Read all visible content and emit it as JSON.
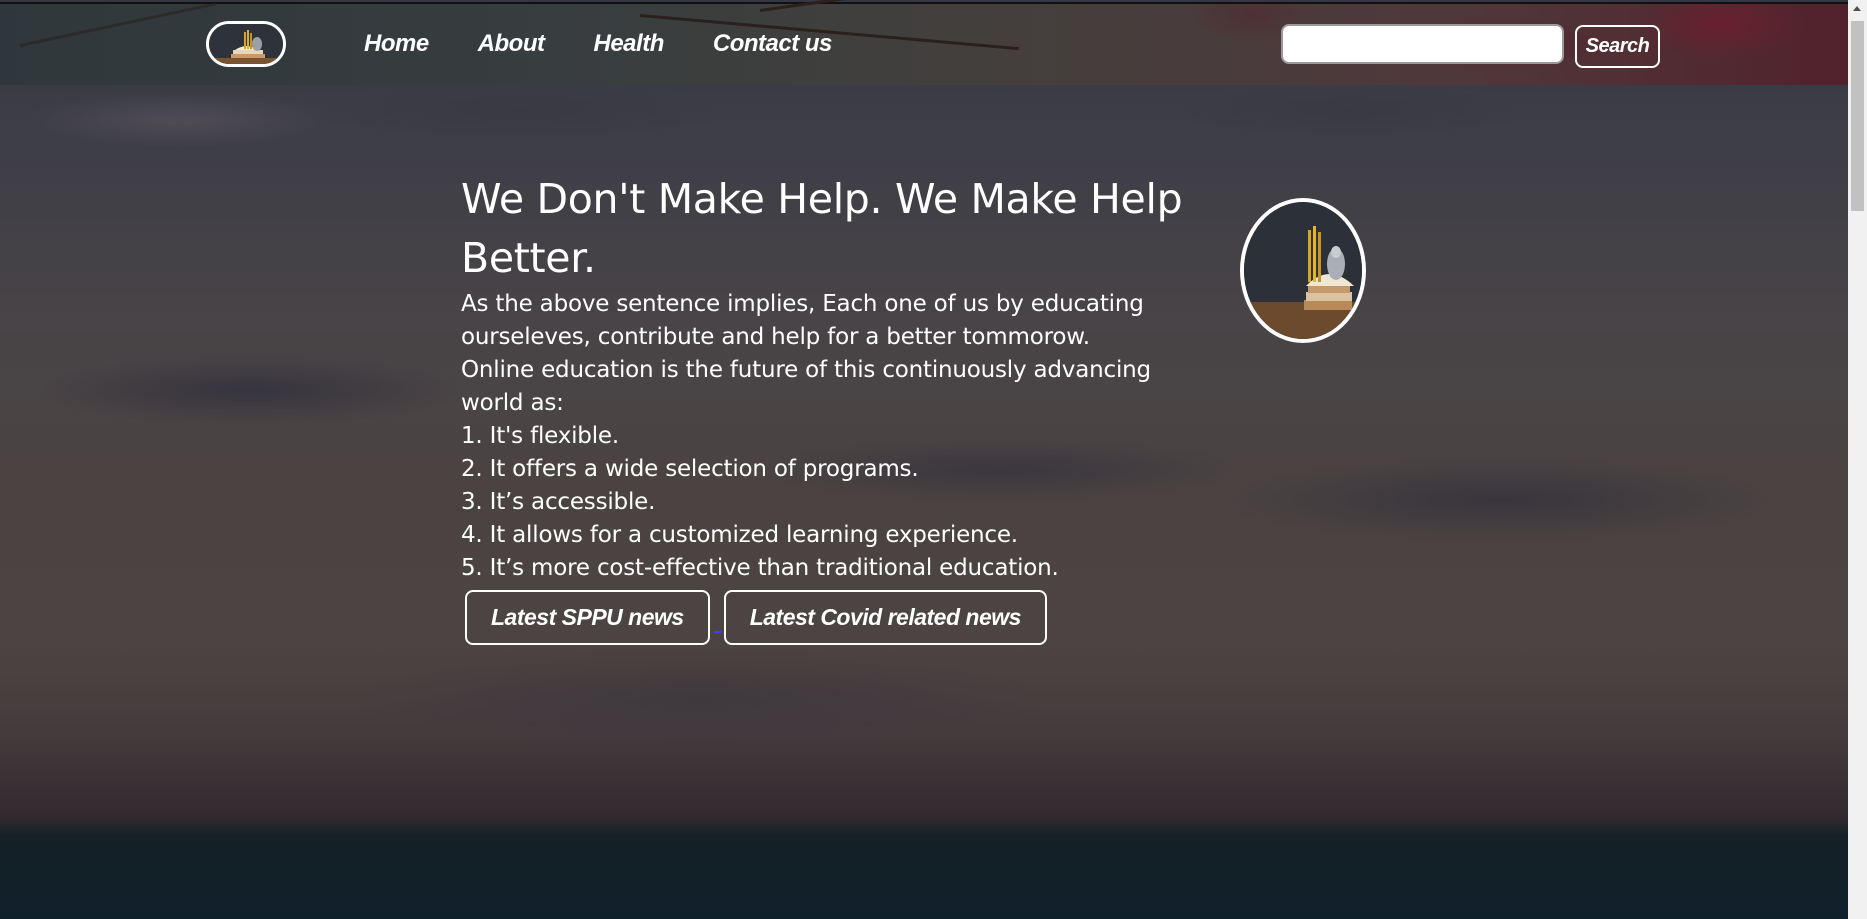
{
  "navbar": {
    "logo_name": "books-logo",
    "links": [
      {
        "label": "Home"
      },
      {
        "label": "About"
      },
      {
        "label": "Health"
      },
      {
        "label": "Contact us"
      }
    ],
    "search": {
      "placeholder": "",
      "value": "",
      "button_label": "Search"
    }
  },
  "hero": {
    "title": "We Don't Make Help. We Make Help Better.",
    "intro": "As the above sentence implies, Each one of us by educating ourseleves, contribute and help for a better tommorow.",
    "lead": "Online education is the future of this continuously advancing world as:",
    "points": [
      "1. It's flexible.",
      "2. It offers a wide selection of programs.",
      "3. It’s accessible.",
      "4. It allows for a customized learning experience.",
      "5. It’s more cost-effective than traditional education."
    ],
    "buttons": {
      "sppu": "Latest SPPU news",
      "covid": "Latest Covid related news"
    }
  },
  "colors": {
    "text": "#ffffff",
    "border": "#ffffff",
    "link_separator": "#3c3cff"
  }
}
